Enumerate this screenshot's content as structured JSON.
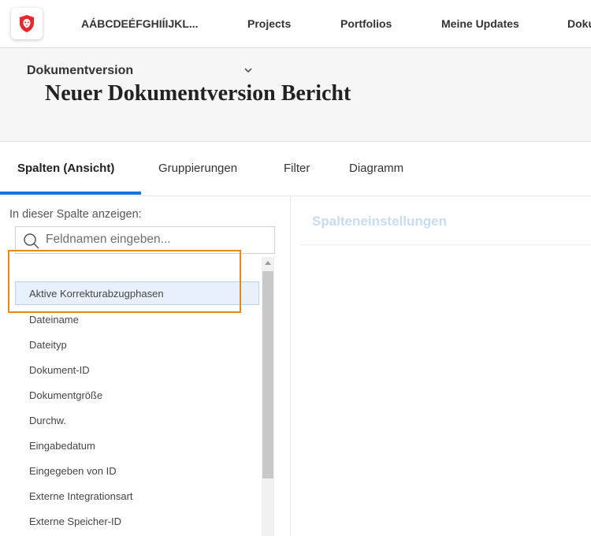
{
  "nav": {
    "workspace": "AÁBCDEÉFGHIÍIJKL...",
    "items": [
      "Projects",
      "Portfolios",
      "Meine Updates",
      "Doku"
    ]
  },
  "page": {
    "title": "Neuer Dokumentversion Bericht"
  },
  "tabs": [
    "Spalten (Ansicht)",
    "Gruppierungen",
    "Filter",
    "Diagramm"
  ],
  "left_panel": {
    "label": "In dieser Spalte anzeigen:",
    "search_placeholder": "Feldnamen eingeben...",
    "group": "Dokumentversion",
    "items": [
      "Aktive Korrekturabzugphasen",
      "Dateiname",
      "Dateityp",
      "Dokument-ID",
      "Dokumentgröße",
      "Durchw.",
      "Eingabedatum",
      "Eingegeben von ID",
      "Externe Integrationsart",
      "Externe Speicher-ID"
    ]
  },
  "right_panel": {
    "title": "Spalteneinstellungen"
  },
  "colors": {
    "accent": "#1473e6",
    "highlight_border": "#e68a17",
    "logo_red": "#e8262b"
  }
}
